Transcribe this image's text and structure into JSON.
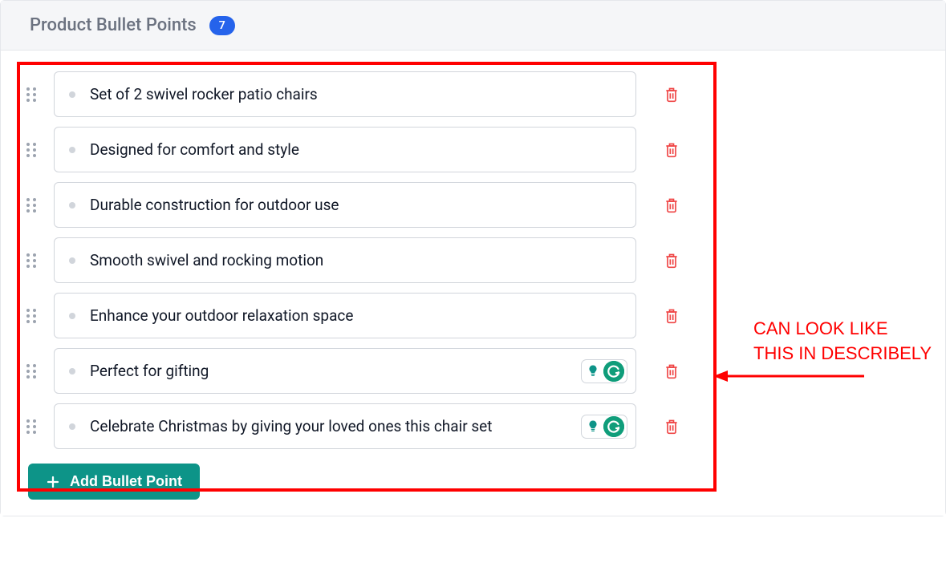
{
  "header": {
    "title": "Product Bullet Points",
    "count": "7"
  },
  "bullets": [
    {
      "text": "Set of 2 swivel rocker patio chairs",
      "show_icons": false
    },
    {
      "text": "Designed for comfort and style",
      "show_icons": false
    },
    {
      "text": "Durable construction for outdoor use",
      "show_icons": false
    },
    {
      "text": "Smooth swivel and rocking motion",
      "show_icons": false
    },
    {
      "text": "Enhance your outdoor relaxation space",
      "show_icons": false
    },
    {
      "text": "Perfect for gifting",
      "show_icons": true
    },
    {
      "text": "Celebrate Christmas by giving your loved ones this chair set",
      "show_icons": true
    }
  ],
  "add_button_label": "Add Bullet Point",
  "annotation_line1": "CAN LOOK LIKE",
  "annotation_line2": "THIS IN DESCRIBELY",
  "colors": {
    "accent_blue": "#2563eb",
    "accent_teal": "#0d9488",
    "danger_red": "#ef4444",
    "highlight_red": "#ff0000"
  }
}
